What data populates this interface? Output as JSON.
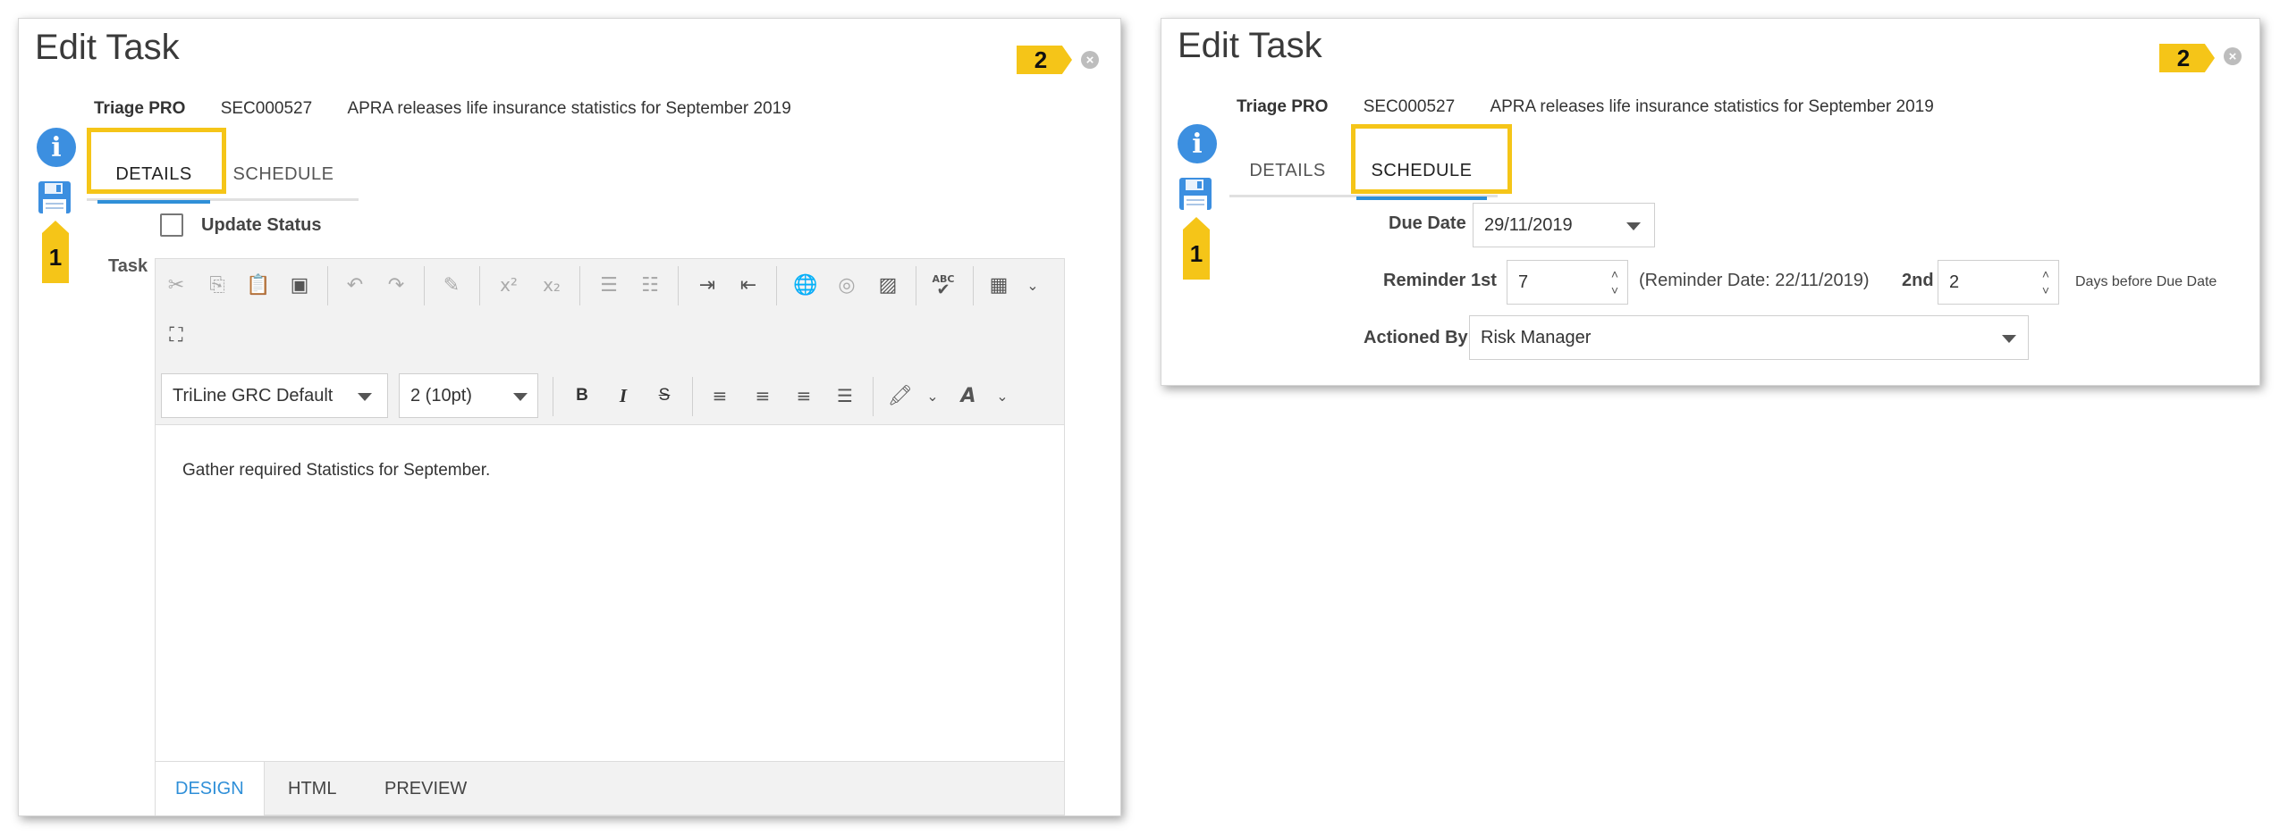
{
  "left_dialog": {
    "title": "Edit Task",
    "callout_top": "2",
    "callout_side": "1",
    "meta": {
      "app": "Triage PRO",
      "code": "SEC000527",
      "subject": "APRA releases life insurance statistics for September 2019"
    },
    "tabs": [
      "DETAILS",
      "SCHEDULE"
    ],
    "active_tab": "DETAILS",
    "update_status_label": "Update Status",
    "task_label": "Task",
    "font_family_value": "TriLine GRC Default",
    "font_size_value": "2 (10pt)",
    "editor_text": "Gather required Statistics for September.",
    "bottom_tabs": [
      "DESIGN",
      "HTML",
      "PREVIEW"
    ],
    "toolbar_icons": {
      "superscript": "x²",
      "subscript": "x₂",
      "bold": "B",
      "italic": "I",
      "strike": "S",
      "spell": "ABC"
    }
  },
  "right_dialog": {
    "title": "Edit Task",
    "callout_top": "2",
    "callout_side": "1",
    "meta": {
      "app": "Triage PRO",
      "code": "SEC000527",
      "subject": "APRA releases life insurance statistics for September 2019"
    },
    "tabs": [
      "DETAILS",
      "SCHEDULE"
    ],
    "active_tab": "SCHEDULE",
    "due_date_label": "Due Date",
    "due_date_value": "29/11/2019",
    "reminder_label": "Reminder",
    "first_label": "1st",
    "first_value": "7",
    "reminder_date_text": "(Reminder Date: 22/11/2019)",
    "second_label": "2nd",
    "second_value": "2",
    "days_before_text": "Days before Due Date",
    "actioned_by_label": "Actioned By",
    "actioned_by_value": "Risk Manager"
  },
  "colors": {
    "accent": "#2f8fd8",
    "highlight": "#f5c518",
    "info": "#3c8fe0"
  },
  "icons": [
    "info-icon",
    "save-icon",
    "close-icon",
    "cut-icon",
    "copy-icon",
    "paste-icon",
    "paste-word-icon",
    "undo-icon",
    "redo-icon",
    "format-painter-icon",
    "ordered-list-icon",
    "unordered-list-icon",
    "indent-icon",
    "outdent-icon",
    "globe-link-icon",
    "globe-unlink-icon",
    "image-icon",
    "spellcheck-icon",
    "table-icon",
    "fullscreen-icon",
    "align-left-icon",
    "align-center-icon",
    "align-right-icon",
    "justify-icon",
    "highlight-color-icon",
    "font-color-icon"
  ]
}
